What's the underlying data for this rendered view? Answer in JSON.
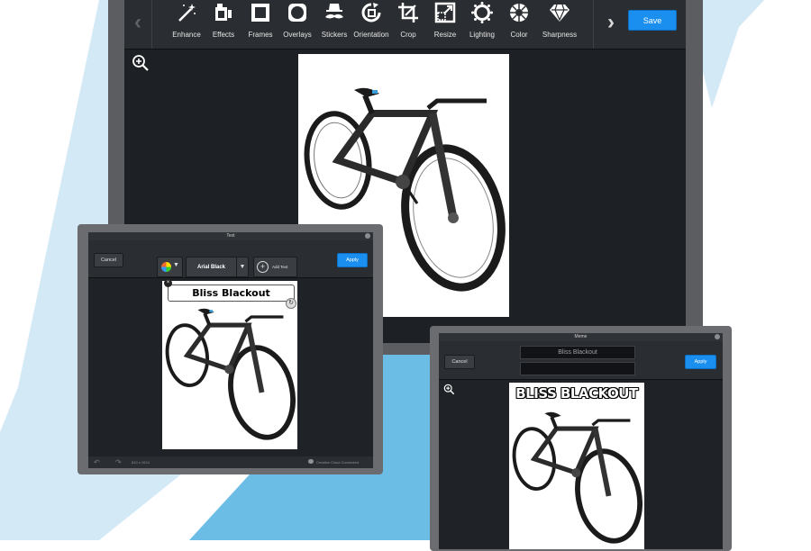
{
  "colors": {
    "accent": "#1a8ff0",
    "background_stripe": "#6bbde6",
    "background_stripe_light": "#d4e9f6",
    "panel": "#1f2226",
    "frame": "#5b5d60"
  },
  "main_editor": {
    "tools": [
      {
        "label": "Enhance",
        "icon": "magic-wand-icon"
      },
      {
        "label": "Effects",
        "icon": "effects-icon"
      },
      {
        "label": "Frames",
        "icon": "frame-icon"
      },
      {
        "label": "Overlays",
        "icon": "overlay-icon"
      },
      {
        "label": "Stickers",
        "icon": "mustache-sticker-icon"
      },
      {
        "label": "Orientation",
        "icon": "rotate-icon"
      },
      {
        "label": "Crop",
        "icon": "crop-icon"
      },
      {
        "label": "Resize",
        "icon": "resize-icon"
      },
      {
        "label": "Lighting",
        "icon": "sun-icon"
      },
      {
        "label": "Color",
        "icon": "color-wheel-icon"
      },
      {
        "label": "Sharpness",
        "icon": "diamond-icon"
      }
    ],
    "prev_icon": "‹",
    "next_icon": "›",
    "save_label": "Save"
  },
  "text_dialog": {
    "title": "Text",
    "cancel_label": "Cancel",
    "font_name": "Arial Black",
    "add_text_label": "Add Text",
    "apply_label": "Apply",
    "text_value": "Bliss Blackout",
    "image_size": "810 x 1024",
    "cc_status": "Creative Cloud Connected"
  },
  "meme_dialog": {
    "title": "Meme",
    "cancel_label": "Cancel",
    "top_text": "Bliss Blackout",
    "bottom_text": "",
    "apply_label": "Apply",
    "caption": "BLISS BLACKOUT"
  }
}
